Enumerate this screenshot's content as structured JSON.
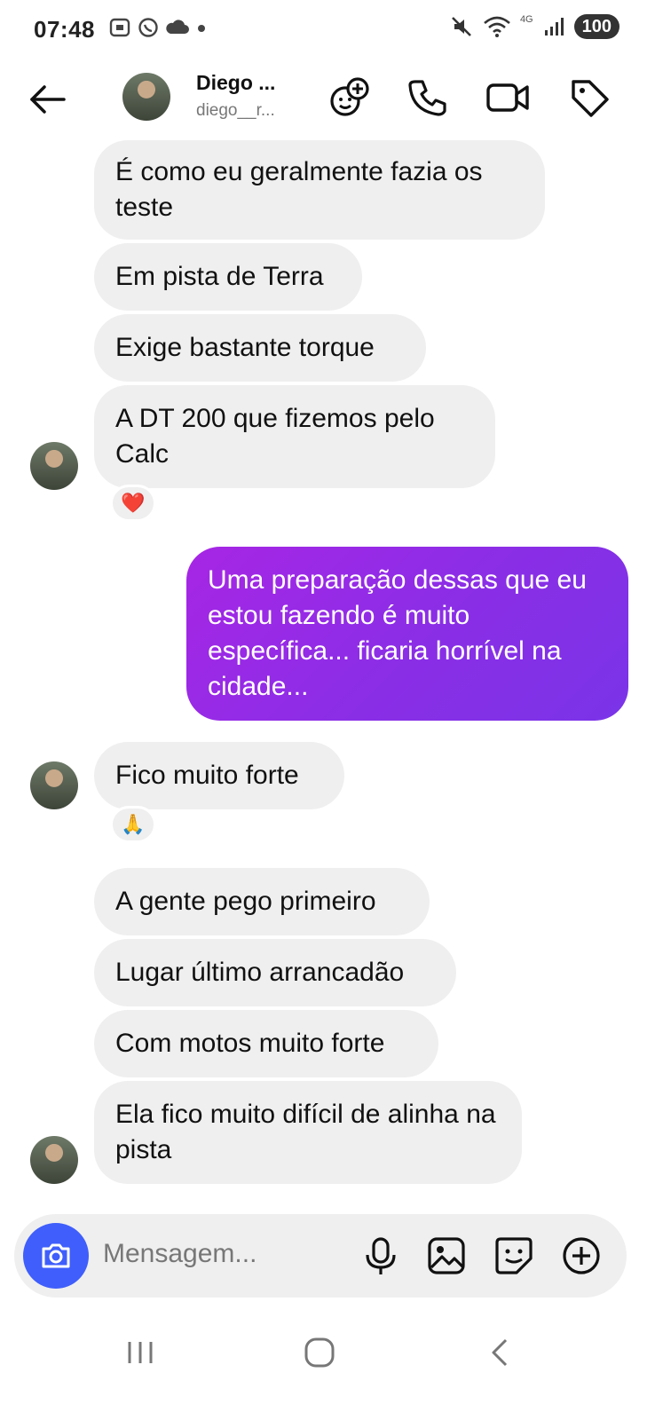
{
  "status_bar": {
    "time": "07:48",
    "network": "4G",
    "battery": "100"
  },
  "header": {
    "name": "Diego ...",
    "username": "diego__r..."
  },
  "messages": [
    {
      "text": "É como eu geralmente fazia os teste",
      "from": "them"
    },
    {
      "text": "Em pista de Terra",
      "from": "them"
    },
    {
      "text": "Exige bastante torque",
      "from": "them"
    },
    {
      "text": "A DT 200 que fizemos pelo Calc",
      "from": "them",
      "reaction": "❤️"
    },
    {
      "text": "Uma preparação dessas que eu estou fazendo é muito específica... ficaria horrível na cidade...",
      "from": "me"
    },
    {
      "text": "Fico muito forte",
      "from": "them",
      "reaction": "🙏"
    },
    {
      "text": "A gente pego primeiro",
      "from": "them"
    },
    {
      "text": "Lugar último arrancadão",
      "from": "them"
    },
    {
      "text": "Com motos muito forte",
      "from": "them"
    },
    {
      "text": "Ela fico muito difícil de alinha na pista",
      "from": "them"
    }
  ],
  "composer": {
    "placeholder": "Mensagem..."
  },
  "colors": {
    "sent_bubble": "#8a2ee6",
    "received_bubble": "#efefef",
    "camera_button": "#3f5efb"
  },
  "icons": [
    "back-arrow-icon",
    "add-friend-icon",
    "phone-icon",
    "video-icon",
    "tag-icon",
    "camera-icon",
    "mic-icon",
    "gallery-icon",
    "sticker-icon",
    "plus-icon"
  ]
}
